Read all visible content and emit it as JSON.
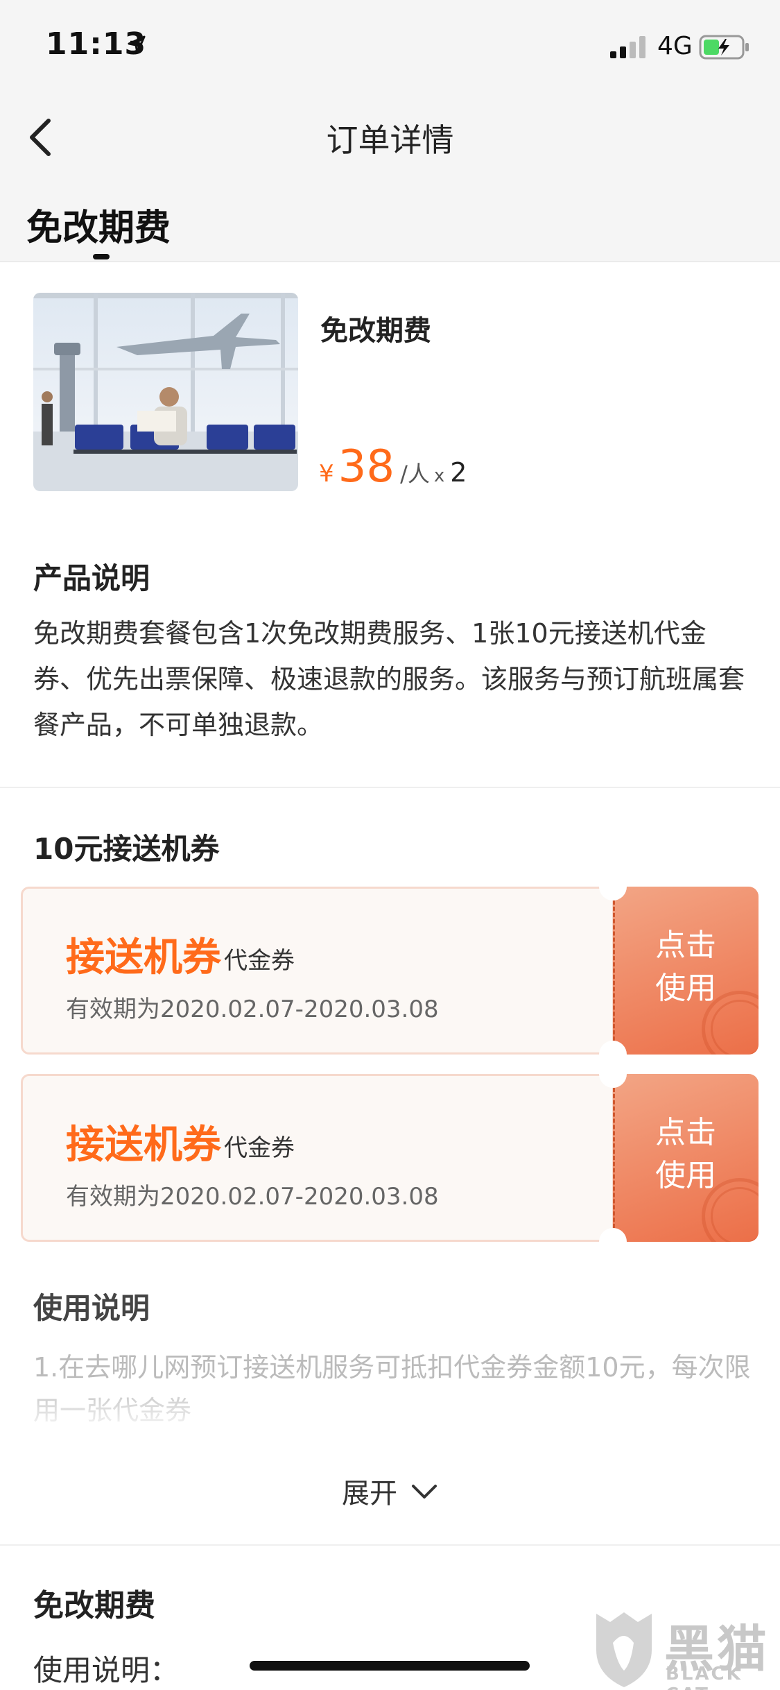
{
  "status_bar": {
    "time": "11:13",
    "network": "4G"
  },
  "nav": {
    "title": "订单详情",
    "back_icon": "chevron-left-icon"
  },
  "tab": {
    "label": "免改期费"
  },
  "product": {
    "name": "免改期费",
    "currency": "¥",
    "price": "38",
    "unit": "/人",
    "times": "x",
    "quantity": "2"
  },
  "product_description": {
    "heading": "产品说明",
    "text": "免改期费套餐包含1次免改期费服务、1张10元接送机代金券、优先出票保障、极速退款的服务。该服务与预订航班属套餐产品，不可单独退款。"
  },
  "coupon_section": {
    "heading": "10元接送机券",
    "coupons": [
      {
        "name": "接送机券",
        "type": "代金券",
        "validity": "有效期为2020.02.07-2020.03.08",
        "action": "点击使用"
      },
      {
        "name": "接送机券",
        "type": "代金券",
        "validity": "有效期为2020.02.07-2020.03.08",
        "action": "点击使用"
      }
    ]
  },
  "usage": {
    "heading": "使用说明",
    "text": "1.在去哪儿网预订接送机服务可抵扣代金券金额10元，每次限用一张代金券",
    "expand_label": "展开"
  },
  "bottom": {
    "title": "免改期费",
    "label": "使用说明："
  },
  "watermark": {
    "cn": "黑猫",
    "en": "BLACK CAT"
  },
  "colors": {
    "accent": "#ff6a1a",
    "coupon_action": "#ec6f48",
    "background": "#f5f5f5"
  }
}
